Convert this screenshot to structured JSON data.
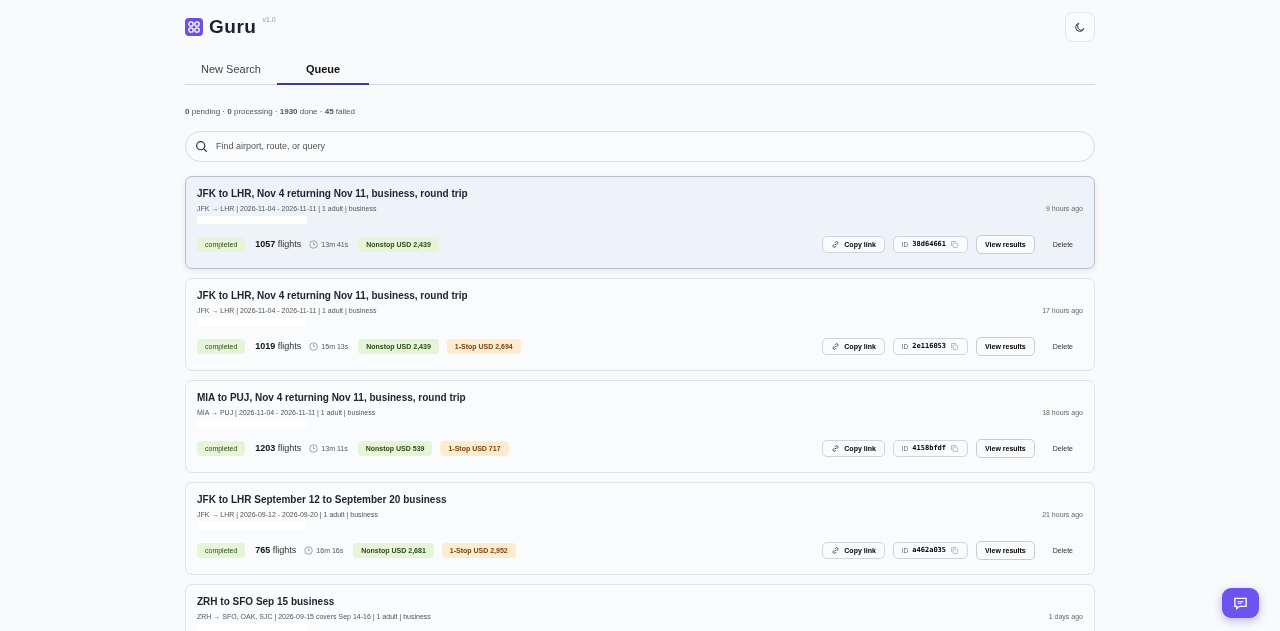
{
  "app": {
    "name": "Guru",
    "version": "v1.0"
  },
  "tabs": [
    {
      "label": "New Search",
      "selected": false
    },
    {
      "label": "Queue",
      "selected": true
    }
  ],
  "stats": "**0** pending · **0** processing · **1930** done · **45** failed",
  "search": {
    "placeholder": "Find airport, route, or query"
  },
  "jobs": [
    {
      "title": "JFK to LHR, Nov 4 returning Nov 11, business, round trip",
      "subtitle": "JFK → LHR | 2026-11-04 - 2026-11-11 | 1 adult | business",
      "time": "9 hours ago",
      "selected": true,
      "status": "completed",
      "flights": "1057",
      "flights_label": "flights",
      "duration": "13m 41s",
      "fares": [
        {
          "kind": "nonstop",
          "label": "Nonstop USD 2,439"
        }
      ],
      "copy": "Copy link",
      "id_label": "ID",
      "id": "38d64661",
      "view": "View results",
      "delete": "Delete"
    },
    {
      "title": "JFK to LHR, Nov 4 returning Nov 11, business, round trip",
      "subtitle": "JFK → LHR | 2026-11-04 - 2026-11-11 | 1 adult | business",
      "time": "17 hours ago",
      "selected": false,
      "status": "completed",
      "flights": "1019",
      "flights_label": "flights",
      "duration": "15m 13s",
      "fares": [
        {
          "kind": "nonstop",
          "label": "Nonstop USD 2,439"
        },
        {
          "kind": "onestop",
          "label": "1-Stop USD 2,694"
        }
      ],
      "copy": "Copy link",
      "id_label": "ID",
      "id": "2e116053",
      "view": "View results",
      "delete": "Delete"
    },
    {
      "title": "MIA to PUJ, Nov 4 returning Nov 11, business, round trip",
      "subtitle": "MIA → PUJ | 2026-11-04 - 2026-11-11 | 1 adult | business",
      "time": "18 hours ago",
      "selected": false,
      "status": "completed",
      "flights": "1203",
      "flights_label": "flights",
      "duration": "13m 11s",
      "fares": [
        {
          "kind": "nonstop",
          "label": "Nonstop USD 539"
        },
        {
          "kind": "onestop",
          "label": "1-Stop USD 717"
        }
      ],
      "copy": "Copy link",
      "id_label": "ID",
      "id": "4158bfdf",
      "view": "View results",
      "delete": "Delete"
    },
    {
      "title": "JFK to LHR September 12 to September 20 business",
      "subtitle": "JFK → LHR | 2026-09-12 - 2026-09-20 | 1 adult | business",
      "time": "21 hours ago",
      "selected": false,
      "status": "completed",
      "flights": "765",
      "flights_label": "flights",
      "duration": "16m 16s",
      "fares": [
        {
          "kind": "nonstop",
          "label": "Nonstop USD 2,681"
        },
        {
          "kind": "onestop",
          "label": "1-Stop USD 2,952"
        }
      ],
      "copy": "Copy link",
      "id_label": "ID",
      "id": "a462a035",
      "view": "View results",
      "delete": "Delete"
    },
    {
      "title": "ZRH to SFO Sep 15 business",
      "subtitle": "ZRH → SFO, OAK, SJC | 2026-09-15",
      "note": "covers Sep 14-16",
      "subtitle_end": "| 1 adult | business",
      "time": "1 days ago",
      "selected": false
    }
  ]
}
